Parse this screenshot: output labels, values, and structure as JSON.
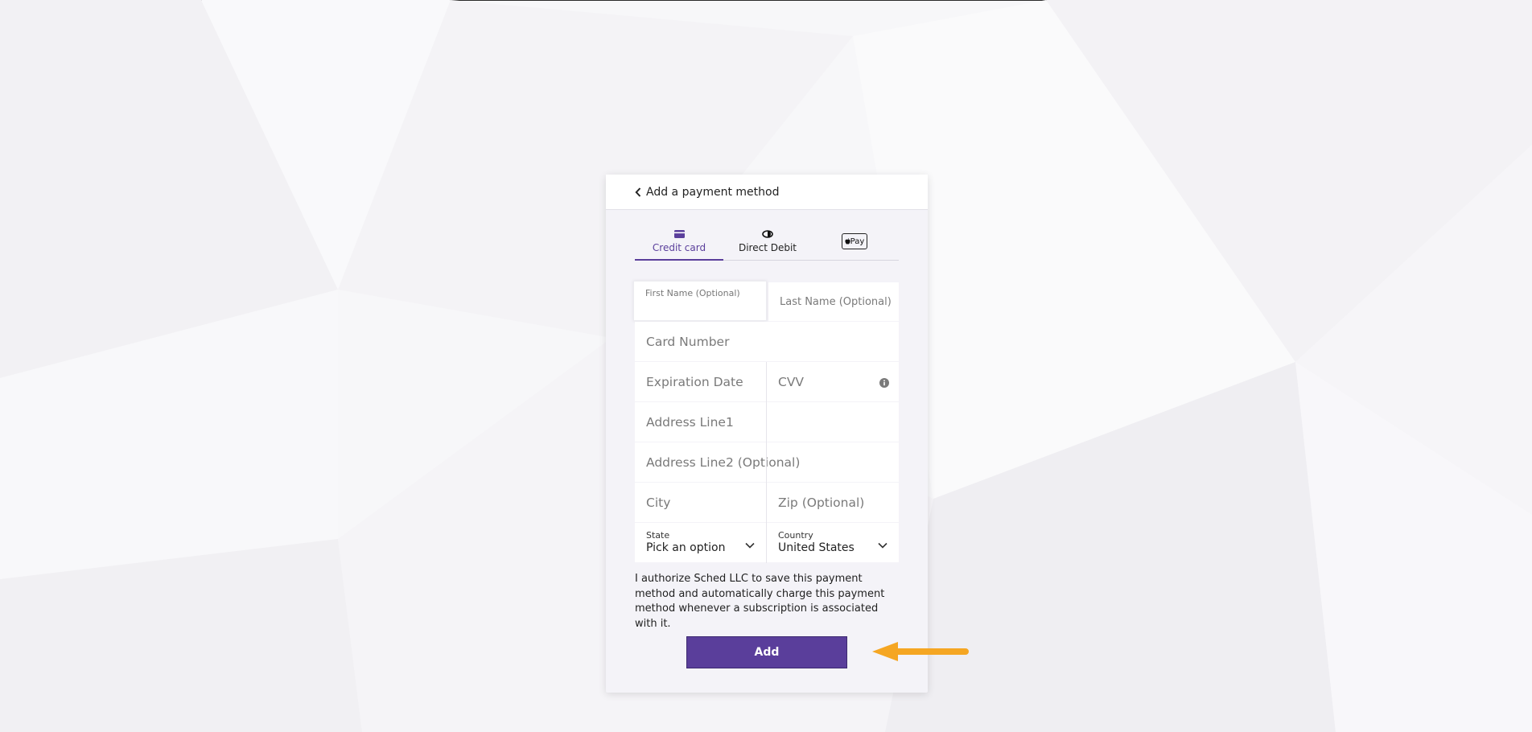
{
  "header": {
    "back_label": "Add a payment method"
  },
  "tabs": [
    {
      "label": "Credit card",
      "icon": "credit-card-icon",
      "active": true
    },
    {
      "label": "Direct Debit",
      "icon": "direct-debit-icon",
      "active": false
    },
    {
      "label": "Pay",
      "icon": "apple-pay-icon",
      "active": false
    }
  ],
  "form": {
    "first_name_placeholder": "First Name (Optional)",
    "last_name_placeholder": "Last Name (Optional)",
    "card_number_placeholder": "Card Number",
    "expiration_placeholder": "Expiration Date",
    "cvv_placeholder": "CVV",
    "address1_placeholder": "Address Line1",
    "address2_placeholder": "Address Line2 (Optional)",
    "city_placeholder": "City",
    "zip_placeholder": "Zip (Optional)",
    "state_label": "State",
    "state_value": "Pick an option",
    "country_label": "Country",
    "country_value": "United States"
  },
  "authorization_text": "I authorize Sched LLC to save this payment method and automatically charge this payment method whenever a subscription is associated with it.",
  "add_button_label": "Add",
  "colors": {
    "accent": "#5a3e9b",
    "arrow": "#f5a623"
  }
}
